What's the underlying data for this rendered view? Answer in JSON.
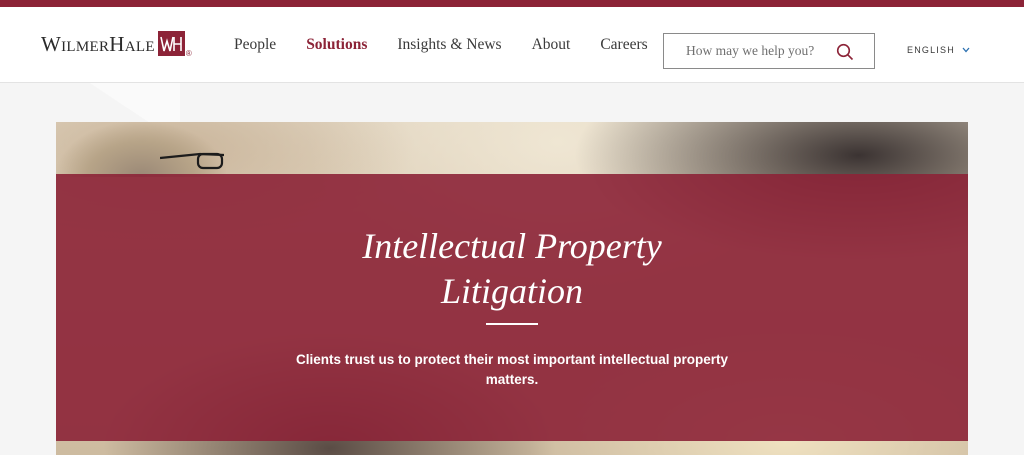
{
  "brand": {
    "name": "WilmerHale",
    "monogram": "WH",
    "registered_mark": "®",
    "color": "#8c2337"
  },
  "nav": {
    "items": [
      {
        "label": "People",
        "active": false
      },
      {
        "label": "Solutions",
        "active": true
      },
      {
        "label": "Insights & News",
        "active": false
      },
      {
        "label": "About",
        "active": false
      },
      {
        "label": "Careers",
        "active": false
      }
    ]
  },
  "search": {
    "placeholder": "How may we help you?",
    "value": "",
    "icon": "search-icon"
  },
  "language": {
    "label": "ENGLISH",
    "icon": "chevron-down-icon"
  },
  "hero": {
    "title_line1": "Intellectual Property",
    "title_line2": "Litigation",
    "subtitle": "Clients trust us to protect their most important intellectual property matters."
  }
}
